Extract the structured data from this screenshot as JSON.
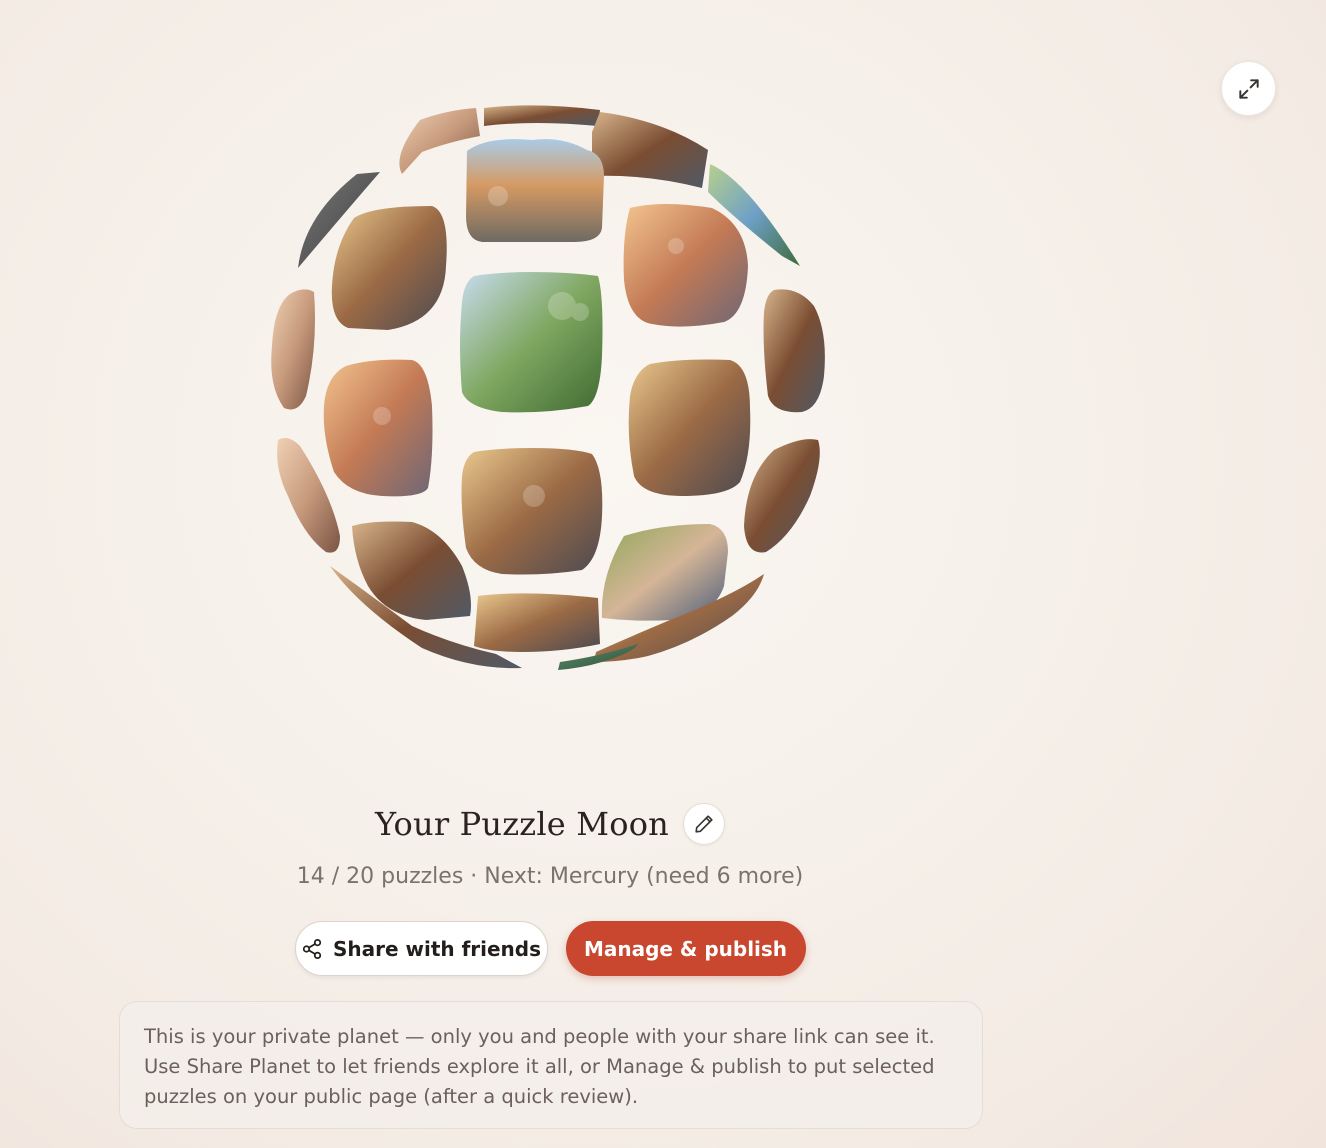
{
  "header": {
    "expand_icon": "expand-arrows-icon"
  },
  "planet": {
    "title": "Your Puzzle Moon",
    "edit_icon": "pencil-icon",
    "progress": "14 / 20 puzzles · Next: Mercury (need 6 more)",
    "tiles": [
      {
        "scene": "family-sofa-dog"
      },
      {
        "scene": "girls-field-balloons"
      },
      {
        "scene": "couple-sunset-window"
      },
      {
        "scene": "couple-dog-puzzle"
      },
      {
        "scene": "boy-balcony-mountains"
      },
      {
        "scene": "family-portrait-grid"
      },
      {
        "scene": "kitten-close-up"
      },
      {
        "scene": "kitten-profile"
      },
      {
        "scene": "couple-dog-home"
      },
      {
        "scene": "dark-puzzle-texture"
      },
      {
        "scene": "garden-flowers"
      },
      {
        "scene": "family-gathering"
      },
      {
        "scene": "couple-dog-cozy"
      },
      {
        "scene": "forest-scene"
      }
    ]
  },
  "actions": {
    "share_label": "Share with friends",
    "share_icon": "share-nodes-icon",
    "manage_label": "Manage & publish"
  },
  "info": {
    "text": "This is your private planet — only you and people with your share link can see it. Use Share Planet to let friends explore it all, or Manage & publish to put selected puzzles on your public page (after a quick review)."
  },
  "colors": {
    "accent": "#c9472e",
    "background": "#f6f0ea",
    "text_muted": "#7c716c"
  }
}
